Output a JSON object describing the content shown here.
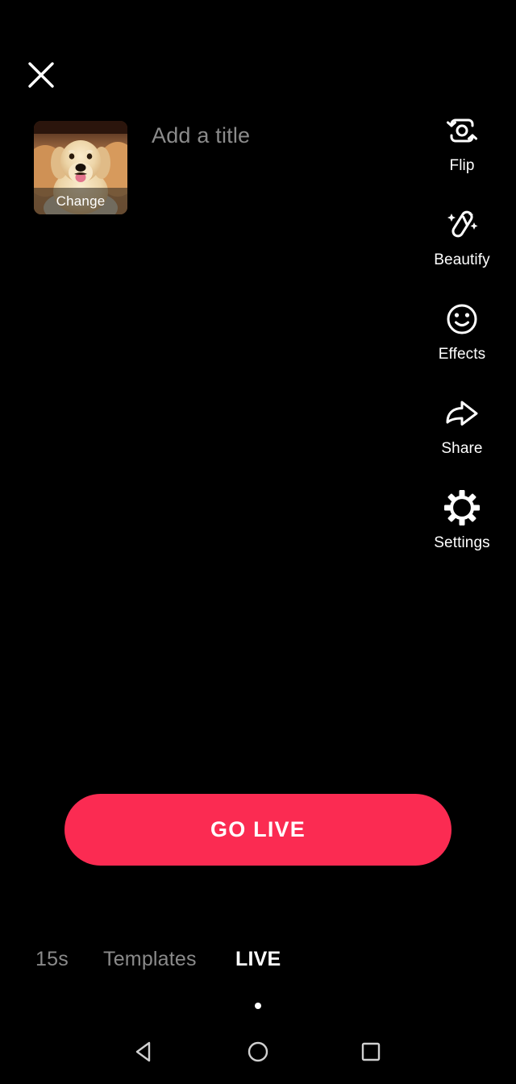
{
  "app": {
    "screen_name": "LIVE",
    "background_color": "#000000"
  },
  "header": {
    "close_label": "close-icon"
  },
  "cover": {
    "change_label": "Change",
    "image_subject": "golden retriever dog"
  },
  "title": {
    "value": "",
    "placeholder": "Add a title"
  },
  "actions": [
    {
      "icon": "flip-icon",
      "label": "Flip"
    },
    {
      "icon": "beautify-icon",
      "label": "Beautify"
    },
    {
      "icon": "effects-icon",
      "label": "Effects"
    },
    {
      "icon": "share-icon",
      "label": "Share"
    },
    {
      "icon": "settings-icon",
      "label": "Settings"
    }
  ],
  "primary_action": {
    "label": "GO LIVE",
    "color": "#fb2b52",
    "text_color": "#ffffff"
  },
  "mode_tabs": [
    {
      "label": "15s",
      "active": false
    },
    {
      "label": "Templates",
      "active": false
    },
    {
      "label": "LIVE",
      "active": true
    }
  ],
  "nav_bar": {
    "back": "back-triangle-icon",
    "home": "home-circle-icon",
    "recents": "recents-square-icon"
  },
  "colors": {
    "accent": "#fb2b52",
    "inactive_text": "#8a8a8a",
    "placeholder_text": "#8b8b8b",
    "active_text": "#ffffff"
  }
}
